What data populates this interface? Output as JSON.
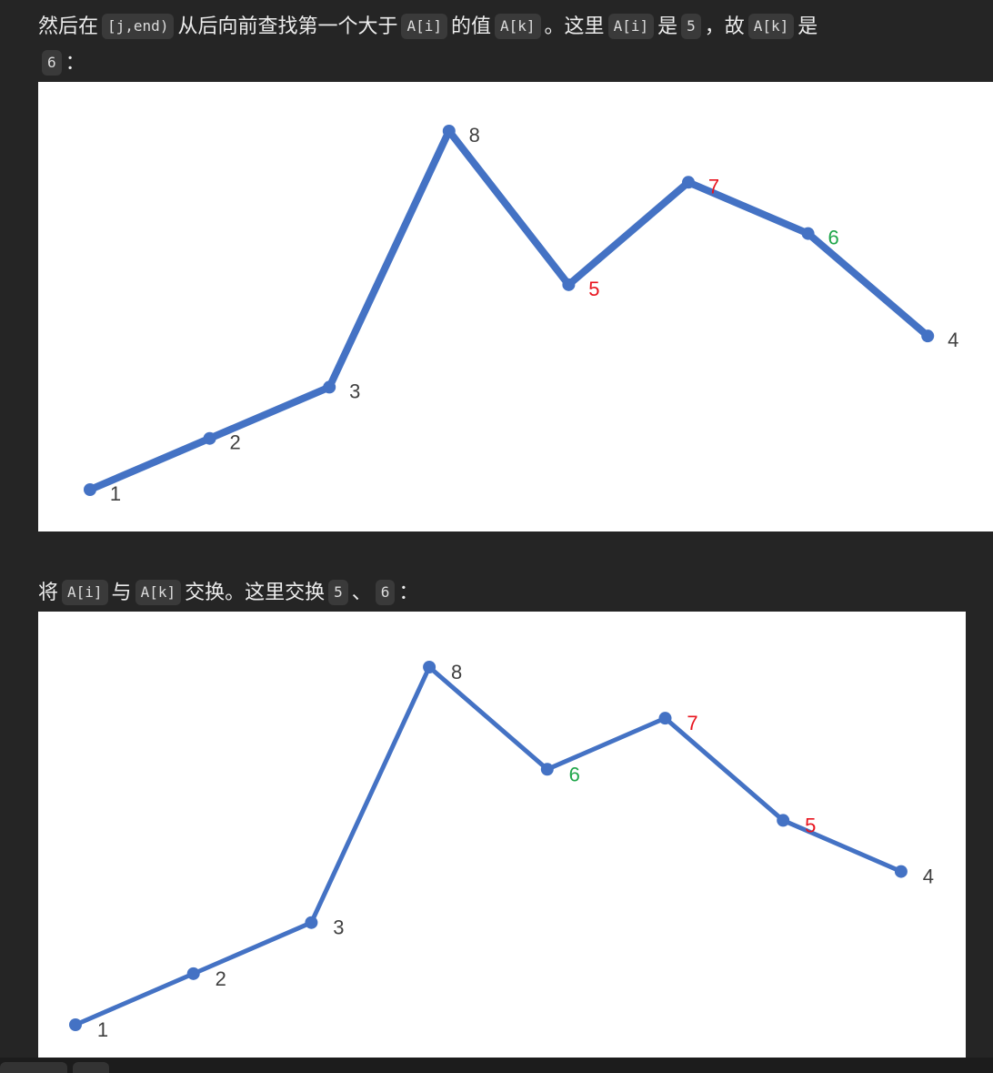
{
  "para1": {
    "t1": "然后在",
    "c1": "[j,end)",
    "t2": "从后向前查找第一个大于",
    "c2": "A[i]",
    "t3": "的值",
    "c3": "A[k]",
    "t4": "。这里",
    "c4": "A[i]",
    "t5": "是",
    "c5": "5",
    "t6": "，故",
    "c6": "A[k]",
    "t7": "是",
    "c7": "6",
    "t8": "："
  },
  "para2": {
    "t1": "将",
    "c1": "A[i]",
    "t2": "与",
    "c2": "A[k]",
    "t3": "交换。这里交换",
    "c3": "5",
    "t4": "、",
    "c4": "6",
    "t5": "："
  },
  "colors": {
    "line": "#4472c4",
    "label_default": "#404040",
    "label_red": "#e8141e",
    "label_green": "#1fa64a"
  },
  "chart_data": [
    {
      "type": "line",
      "x": [
        1,
        2,
        3,
        4,
        5,
        6,
        7,
        8
      ],
      "series": [
        {
          "values": [
            1,
            2,
            3,
            8,
            5,
            7,
            6,
            4
          ],
          "point_labels": [
            "1",
            "2",
            "3",
            "8",
            "5",
            "7",
            "6",
            "4"
          ],
          "label_colors": [
            "default",
            "default",
            "default",
            "default",
            "red",
            "red",
            "green",
            "default"
          ]
        }
      ],
      "ylim": [
        1,
        8
      ],
      "grid": false
    },
    {
      "type": "line",
      "x": [
        1,
        2,
        3,
        4,
        5,
        6,
        7,
        8
      ],
      "series": [
        {
          "values": [
            1,
            2,
            3,
            8,
            6,
            7,
            5,
            4
          ],
          "point_labels": [
            "1",
            "2",
            "3",
            "8",
            "6",
            "7",
            "5",
            "4"
          ],
          "label_colors": [
            "default",
            "default",
            "default",
            "default",
            "green",
            "red",
            "red",
            "default"
          ]
        }
      ],
      "ylim": [
        1,
        8
      ],
      "grid": false
    }
  ]
}
